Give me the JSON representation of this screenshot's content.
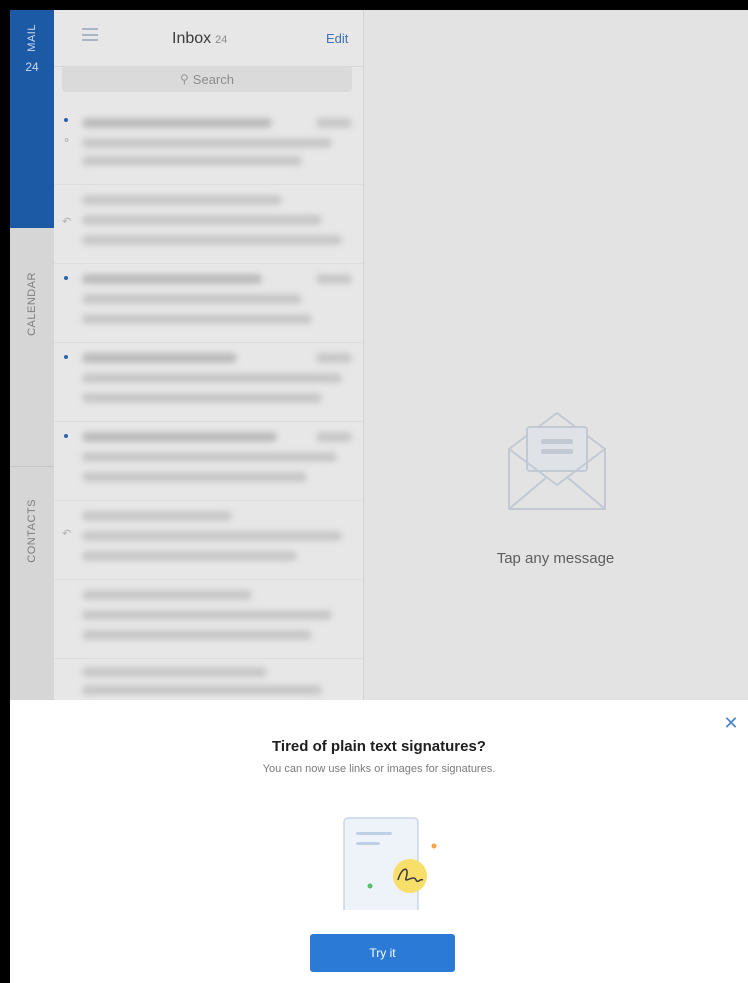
{
  "rail": {
    "mail_label": "MAIL",
    "mail_count": "24",
    "calendar_label": "CALENDAR",
    "contacts_label": "CONTACTS"
  },
  "list": {
    "title": "Inbox",
    "count": "24",
    "edit_label": "Edit",
    "search_placeholder": "Search"
  },
  "reading": {
    "empty_text": "Tap any message"
  },
  "sheet": {
    "title": "Tired of plain text signatures?",
    "subtitle": "You can now use links or images for signatures.",
    "button_label": "Try it",
    "close_glyph": "✕"
  },
  "colors": {
    "accent": "#2b7ad6",
    "mail_tab": "#1d5aa6"
  }
}
